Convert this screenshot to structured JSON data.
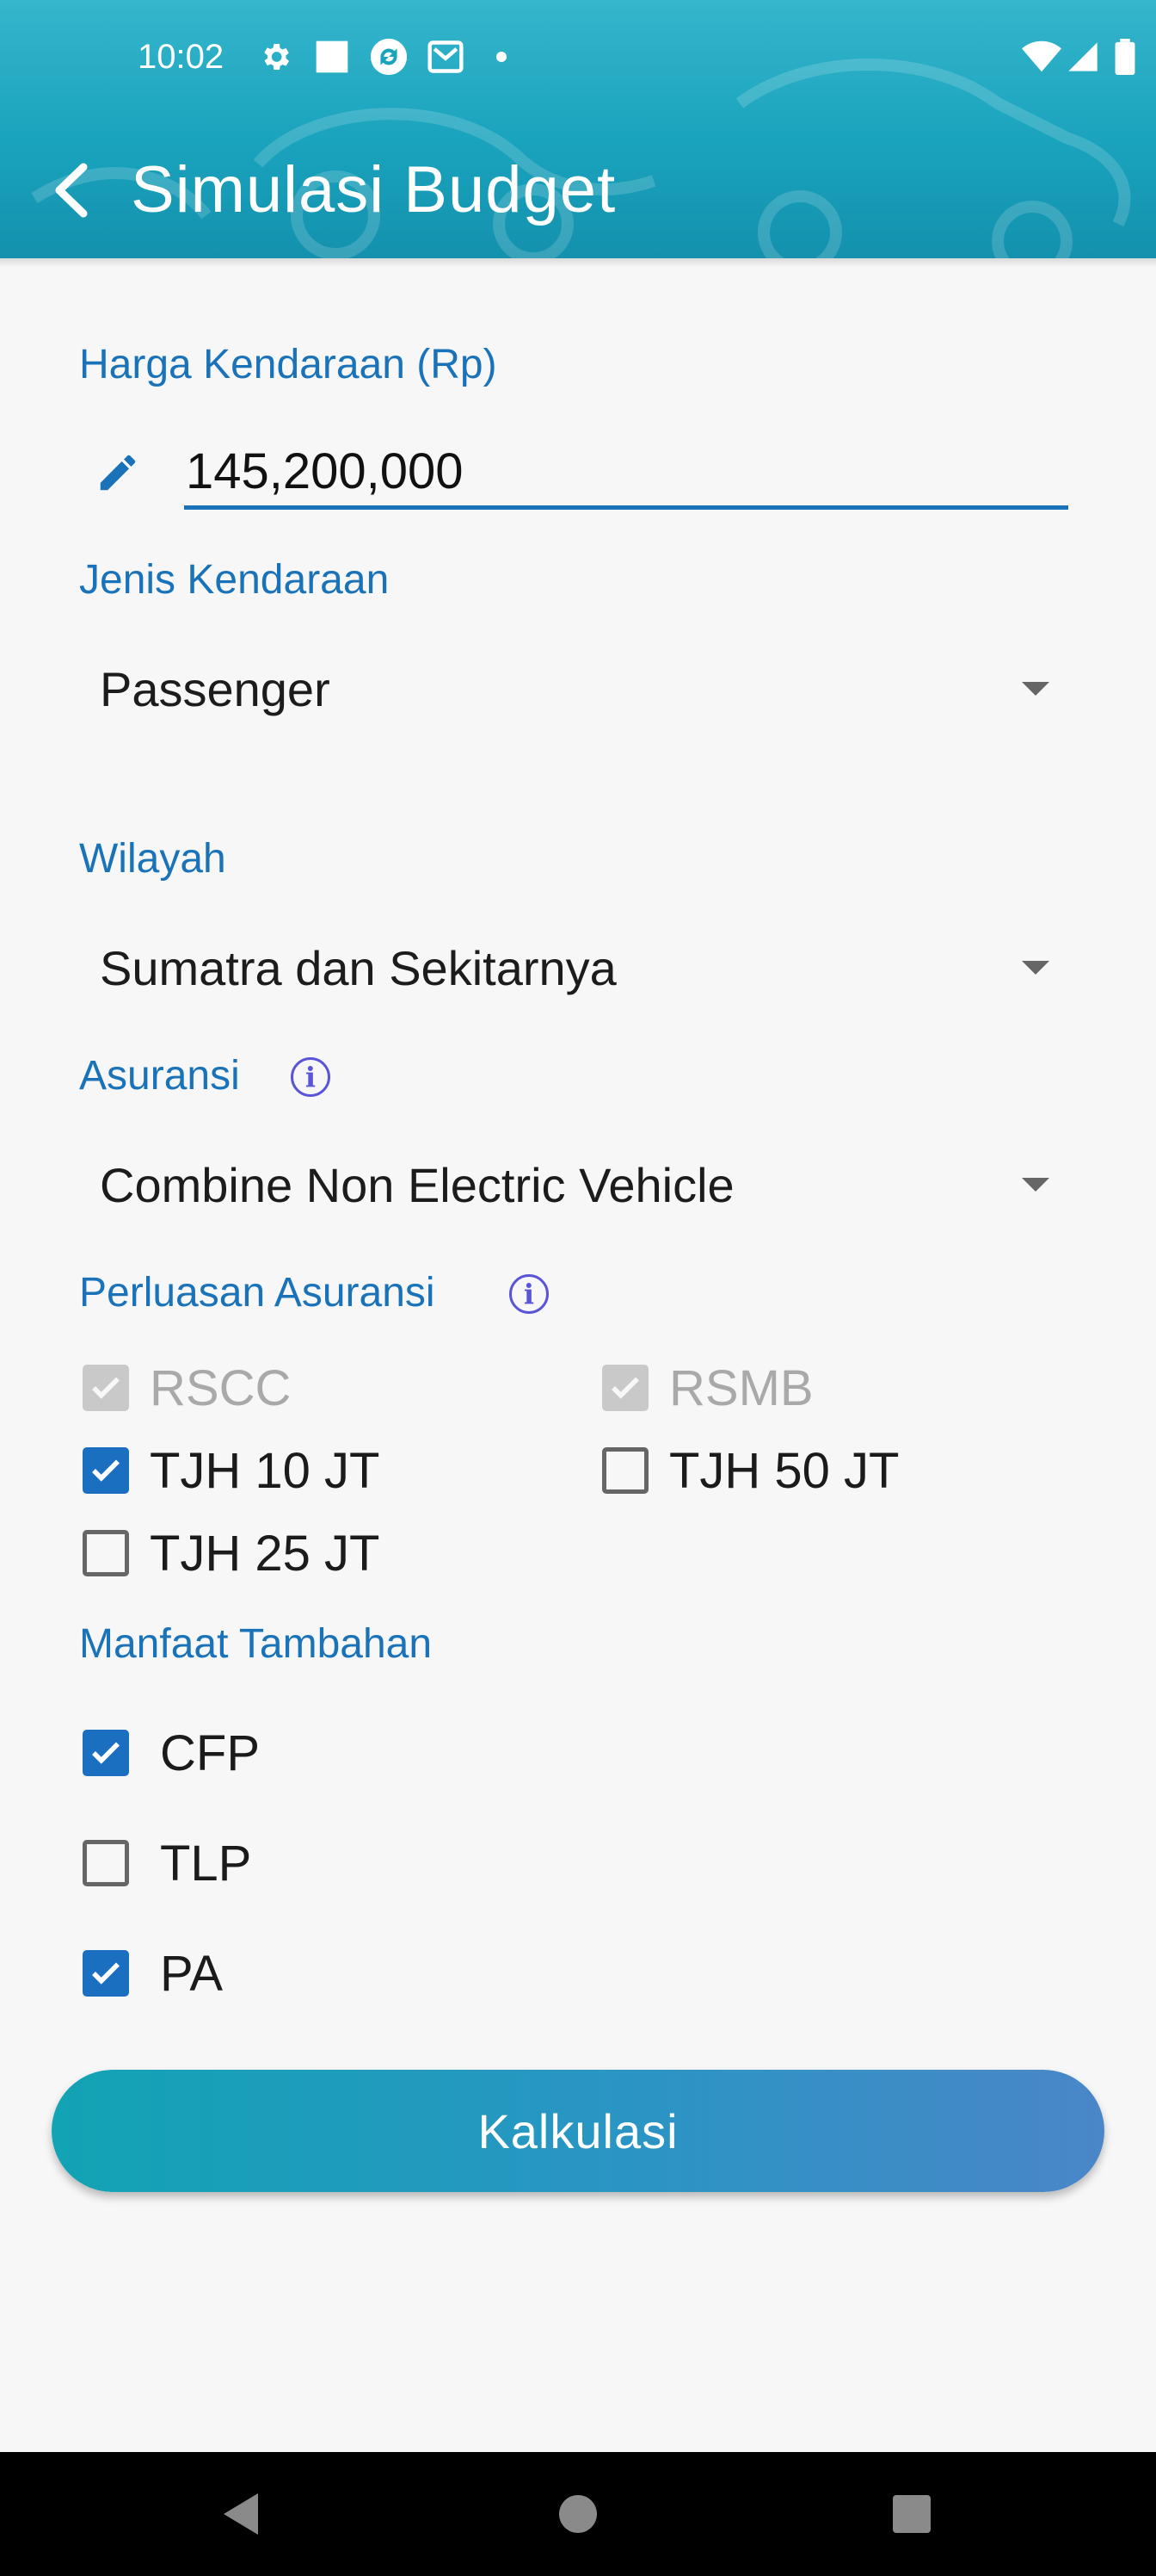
{
  "status_bar": {
    "time": "10:02",
    "left_icons": [
      "gear-icon",
      "square-icon",
      "sync-icon",
      "mail-icon",
      "dot-icon"
    ],
    "right_icons": [
      "wifi-icon",
      "signal-icon",
      "battery-icon"
    ]
  },
  "app_bar": {
    "title": "Simulasi Budget",
    "back_icon": "arrow-back-icon"
  },
  "form": {
    "price": {
      "label": "Harga Kendaraan (Rp)",
      "value": "145,200,000",
      "icon": "pencil-icon"
    },
    "vehicle_type": {
      "label": "Jenis Kendaraan",
      "value": "Passenger"
    },
    "region": {
      "label": "Wilayah",
      "value": "Sumatra dan Sekitarnya"
    },
    "insurance": {
      "label": "Asuransi",
      "value": "Combine Non Electric Vehicle",
      "info_icon": "info-icon"
    },
    "extension": {
      "label": "Perluasan Asuransi",
      "info_icon": "info-icon",
      "options": [
        {
          "label": "RSCC",
          "checked": true,
          "disabled": true
        },
        {
          "label": "RSMB",
          "checked": true,
          "disabled": true
        },
        {
          "label": "TJH 10 JT",
          "checked": true,
          "disabled": false
        },
        {
          "label": "TJH 50 JT",
          "checked": false,
          "disabled": false
        },
        {
          "label": "TJH 25 JT",
          "checked": false,
          "disabled": false
        }
      ]
    },
    "benefits": {
      "label": "Manfaat Tambahan",
      "options": [
        {
          "label": "CFP",
          "checked": true
        },
        {
          "label": "TLP",
          "checked": false
        },
        {
          "label": "PA",
          "checked": true
        }
      ]
    },
    "submit_label": "Kalkulasi"
  },
  "colors": {
    "primary": "#1a73b8",
    "checkbox_checked": "#1a6fc1",
    "header_teal": "#1aa3bd",
    "button_gradient_start": "#12a3b4",
    "button_gradient_end": "#4a86c8"
  },
  "nav_bar": {
    "items": [
      "back-triangle-icon",
      "home-circle-icon",
      "recents-square-icon"
    ]
  }
}
